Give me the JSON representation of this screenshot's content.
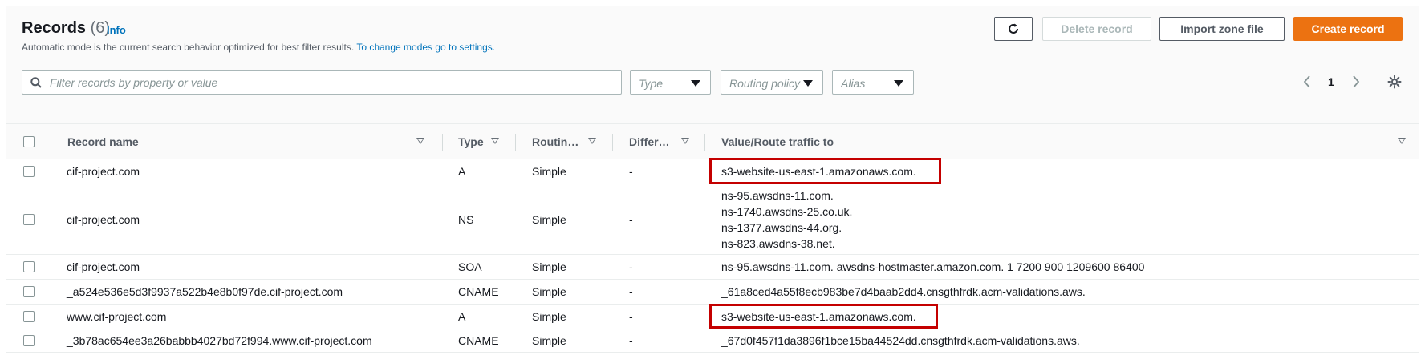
{
  "header": {
    "title": "Records",
    "count": "(6)",
    "info_link": "Info",
    "description": "Automatic mode is the current search behavior optimized for best filter results. ",
    "description_link": "To change modes go to settings."
  },
  "toolbar": {
    "delete_label": "Delete record",
    "import_label": "Import zone file",
    "create_label": "Create record"
  },
  "filters": {
    "search_placeholder": "Filter records by property or value",
    "type_label": "Type",
    "routing_label": "Routing policy",
    "alias_label": "Alias"
  },
  "pagination": {
    "page": "1"
  },
  "columns": {
    "name": "Record name",
    "type": "Type",
    "routing": "Routin…",
    "differ": "Differ…",
    "value": "Value/Route traffic to"
  },
  "rows": [
    {
      "name": "cif-project.com",
      "type": "A",
      "routing": "Simple",
      "differ": "-",
      "value": [
        "s3-website-us-east-1.amazonaws.com."
      ]
    },
    {
      "name": "cif-project.com",
      "type": "NS",
      "routing": "Simple",
      "differ": "-",
      "value": [
        "ns-95.awsdns-11.com.",
        "ns-1740.awsdns-25.co.uk.",
        "ns-1377.awsdns-44.org.",
        "ns-823.awsdns-38.net."
      ]
    },
    {
      "name": "cif-project.com",
      "type": "SOA",
      "routing": "Simple",
      "differ": "-",
      "value": [
        "ns-95.awsdns-11.com. awsdns-hostmaster.amazon.com. 1 7200 900 1209600 86400"
      ]
    },
    {
      "name": "_a524e536e5d3f9937a522b4e8b0f97de.cif-project.com",
      "type": "CNAME",
      "routing": "Simple",
      "differ": "-",
      "value": [
        "_61a8ced4a55f8ecb983be7d4baab2dd4.cnsgthfrdk.acm-validations.aws."
      ]
    },
    {
      "name": "www.cif-project.com",
      "type": "A",
      "routing": "Simple",
      "differ": "-",
      "value": [
        "s3-website-us-east-1.amazonaws.com."
      ]
    },
    {
      "name": "_3b78ac654ee3a26babbb4027bd72f994.www.cif-project.com",
      "type": "CNAME",
      "routing": "Simple",
      "differ": "-",
      "value": [
        "_67d0f457f1da3896f1bce15ba44524dd.cnsgthfrdk.acm-validations.aws."
      ]
    }
  ],
  "colors": {
    "accent": "#ec7211",
    "link": "#0073bb",
    "highlight": "#c40000"
  }
}
